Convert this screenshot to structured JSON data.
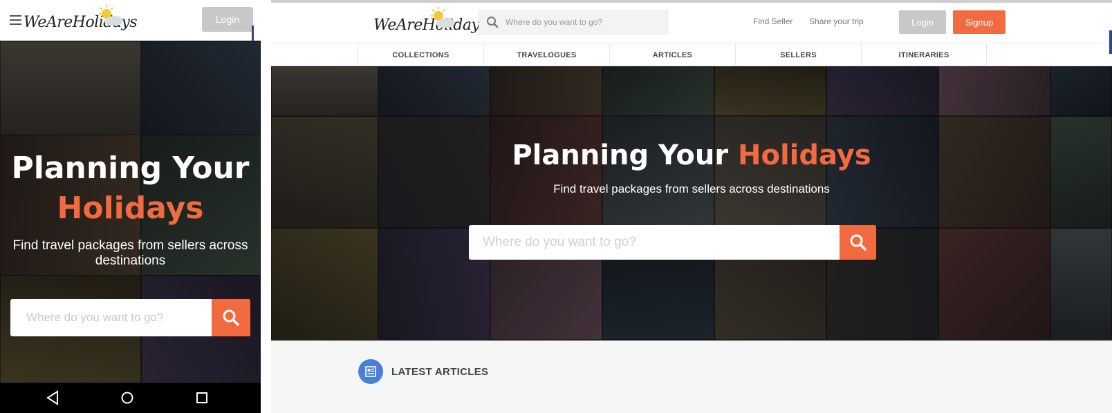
{
  "brand": {
    "logo_text": "WeAreHolidays",
    "accent_color": "#f26a3f",
    "button_grey": "#c8c8c8"
  },
  "mobile": {
    "menu_icon": "hamburger-menu-icon",
    "login_label": "Login",
    "headline_white": "Planning Your",
    "headline_accent": "Holidays",
    "subtitle": "Find travel packages from sellers across destinations",
    "search_placeholder": "Where do you want to go?",
    "search_icon": "search-icon",
    "android_nav": [
      "back-icon",
      "home-icon",
      "recents-icon"
    ]
  },
  "desktop": {
    "search_placeholder": "Where do you want to go?",
    "links": {
      "find_seller": "Find Seller",
      "share_trip": "Share your trip"
    },
    "login_label": "Login",
    "signup_label": "Signup",
    "tabs": [
      "COLLECTIONS",
      "TRAVELOGUES",
      "ARTICLES",
      "SELLERS",
      "ITINERARIES"
    ],
    "headline_white": "Planning Your",
    "headline_accent": "Holidays",
    "subtitle": "Find travel packages from sellers across destinations",
    "hero_search_placeholder": "Where do you want to go?",
    "latest_title": "LATEST ARTICLES",
    "latest_icon": "article-icon"
  }
}
